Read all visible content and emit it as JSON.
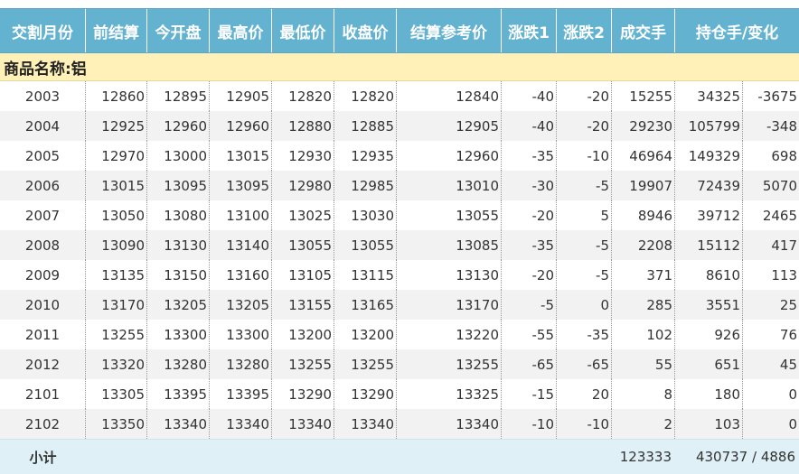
{
  "headers": [
    "交割月份",
    "前结算",
    "今开盘",
    "最高价",
    "最低价",
    "收盘价",
    "结算参考价",
    "涨跌1",
    "涨跌2",
    "成交手",
    "持仓手/变化"
  ],
  "group_label": "商品名称:铝",
  "rows": [
    [
      "2003",
      "12860",
      "12895",
      "12905",
      "12820",
      "12820",
      "12840",
      "-40",
      "-20",
      "15255",
      "34325",
      "-3675"
    ],
    [
      "2004",
      "12925",
      "12960",
      "12960",
      "12880",
      "12885",
      "12905",
      "-40",
      "-20",
      "29230",
      "105799",
      "-348"
    ],
    [
      "2005",
      "12970",
      "13000",
      "13015",
      "12930",
      "12935",
      "12960",
      "-35",
      "-10",
      "46964",
      "149329",
      "698"
    ],
    [
      "2006",
      "13015",
      "13095",
      "13095",
      "12980",
      "12985",
      "13010",
      "-30",
      "-5",
      "19907",
      "72439",
      "5070"
    ],
    [
      "2007",
      "13050",
      "13080",
      "13100",
      "13025",
      "13030",
      "13055",
      "-20",
      "5",
      "8946",
      "39712",
      "2465"
    ],
    [
      "2008",
      "13090",
      "13130",
      "13140",
      "13055",
      "13055",
      "13085",
      "-35",
      "-5",
      "2208",
      "15112",
      "417"
    ],
    [
      "2009",
      "13135",
      "13150",
      "13160",
      "13105",
      "13115",
      "13130",
      "-20",
      "-5",
      "371",
      "8610",
      "113"
    ],
    [
      "2010",
      "13170",
      "13205",
      "13205",
      "13155",
      "13165",
      "13170",
      "-5",
      "0",
      "285",
      "3551",
      "25"
    ],
    [
      "2011",
      "13255",
      "13300",
      "13300",
      "13200",
      "13200",
      "13220",
      "-55",
      "-35",
      "102",
      "926",
      "76"
    ],
    [
      "2012",
      "13320",
      "13280",
      "13280",
      "13255",
      "13255",
      "13255",
      "-65",
      "-65",
      "55",
      "651",
      "45"
    ],
    [
      "2101",
      "13305",
      "13395",
      "13395",
      "13290",
      "13290",
      "13325",
      "-15",
      "20",
      "8",
      "180",
      "0"
    ],
    [
      "2102",
      "13350",
      "13340",
      "13340",
      "13340",
      "13340",
      "13340",
      "-10",
      "-10",
      "2",
      "103",
      "0"
    ]
  ],
  "footer": {
    "label": "小计",
    "volume_total": "123333",
    "open_interest_total": "430737 / 4886"
  }
}
